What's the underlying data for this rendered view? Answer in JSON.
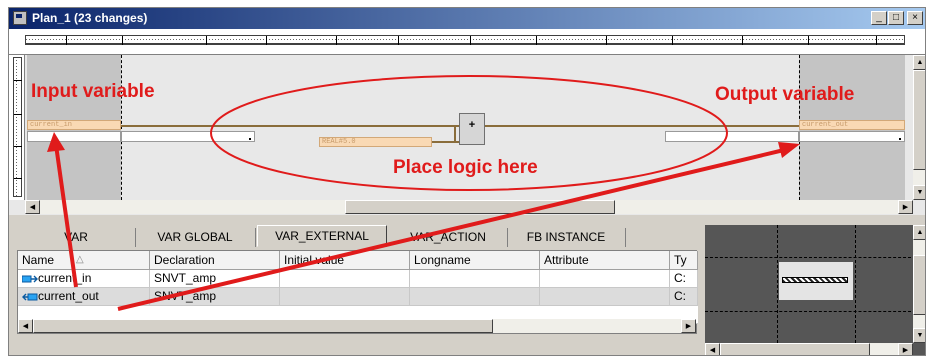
{
  "window": {
    "title": "Plan_1 (23 changes)",
    "controls": [
      "_",
      "□",
      "×"
    ]
  },
  "canvas": {
    "input_var": "current_in",
    "output_var": "current_out",
    "const_var": "REAL#5.0",
    "add_symbol": "+"
  },
  "annotations": {
    "input": "Input variable",
    "output": "Output variable",
    "logic": "Place logic here",
    "colors": {
      "annotation": "#e01b1b",
      "input_zone": "#c4c4c4",
      "var_box": "#f9d9b4"
    }
  },
  "tabs": [
    {
      "label": "VAR",
      "active": false
    },
    {
      "label": "VAR GLOBAL",
      "active": false
    },
    {
      "label": "VAR_EXTERNAL",
      "active": true
    },
    {
      "label": "VAR_ACTION",
      "active": false
    },
    {
      "label": "FB INSTANCE",
      "active": false
    }
  ],
  "table": {
    "columns": [
      "Name",
      "Declaration",
      "Initial value",
      "Longname",
      "Attribute",
      "Ty"
    ],
    "rows": [
      {
        "name": "current_in",
        "icon": "input-arrow-icon",
        "declaration": "SNVT_amp",
        "type": "C:"
      },
      {
        "name": "current_out",
        "icon": "output-arrow-icon",
        "declaration": "SNVT_amp",
        "type": "C:"
      }
    ]
  }
}
